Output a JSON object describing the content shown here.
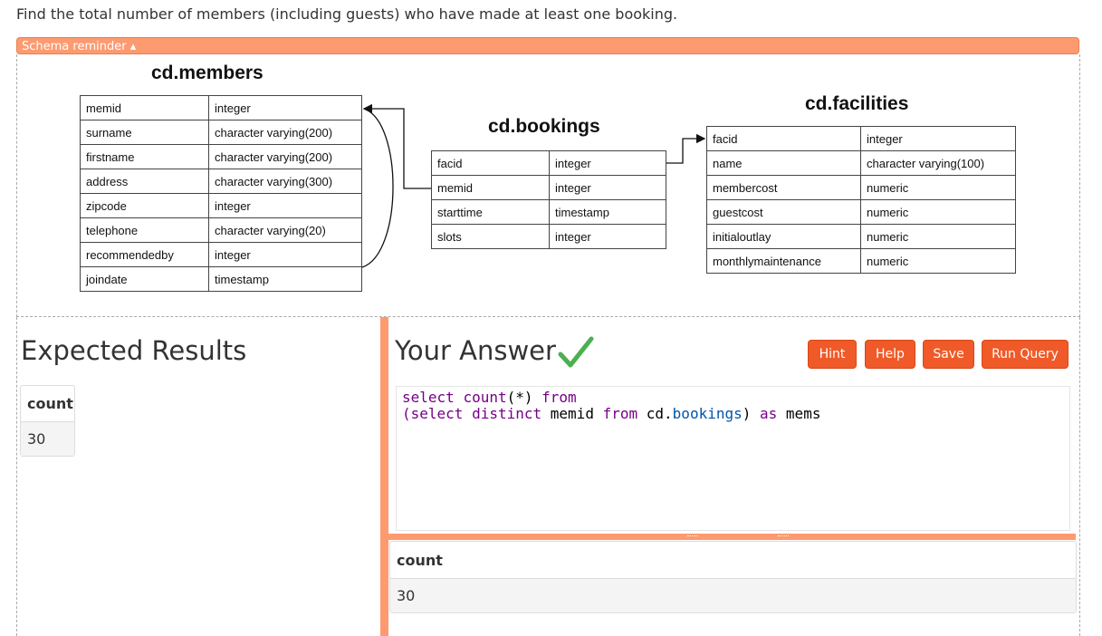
{
  "question": "Find the total number of members (including guests) who have made at least one booking.",
  "schema_toggle": "Schema reminder ▴",
  "schema": {
    "members": {
      "title": "cd.members",
      "rows": [
        [
          "memid",
          "integer"
        ],
        [
          "surname",
          "character varying(200)"
        ],
        [
          "firstname",
          "character varying(200)"
        ],
        [
          "address",
          "character varying(300)"
        ],
        [
          "zipcode",
          "integer"
        ],
        [
          "telephone",
          "character varying(20)"
        ],
        [
          "recommendedby",
          "integer"
        ],
        [
          "joindate",
          "timestamp"
        ]
      ]
    },
    "bookings": {
      "title": "cd.bookings",
      "rows": [
        [
          "facid",
          "integer"
        ],
        [
          "memid",
          "integer"
        ],
        [
          "starttime",
          "timestamp"
        ],
        [
          "slots",
          "integer"
        ]
      ]
    },
    "facilities": {
      "title": "cd.facilities",
      "rows": [
        [
          "facid",
          "integer"
        ],
        [
          "name",
          "character varying(100)"
        ],
        [
          "membercost",
          "numeric"
        ],
        [
          "guestcost",
          "numeric"
        ],
        [
          "initialoutlay",
          "numeric"
        ],
        [
          "monthlymaintenance",
          "numeric"
        ]
      ]
    }
  },
  "expected": {
    "heading": "Expected Results",
    "column": "count",
    "value": "30"
  },
  "answer": {
    "heading": "Your Answer",
    "status_icon": "checkmark-icon",
    "status_color": "#4caf50"
  },
  "buttons": {
    "hint": "Hint",
    "help": "Help",
    "save": "Save",
    "run": "Run Query"
  },
  "query": {
    "line1": {
      "kw1": "select",
      "fn": "count",
      "args": "(*)",
      "kw2": "from"
    },
    "line2": {
      "open": "(",
      "kw1": "select",
      "kw2": "distinct",
      "col": "memid",
      "kw3": "from",
      "schema": "cd.",
      "table": "bookings",
      "close": ")",
      "kw4": "as",
      "alias": "mems"
    }
  },
  "result": {
    "column": "count",
    "value": "30"
  },
  "colors": {
    "accent": "#fd9a70",
    "button": "#f05a28"
  }
}
